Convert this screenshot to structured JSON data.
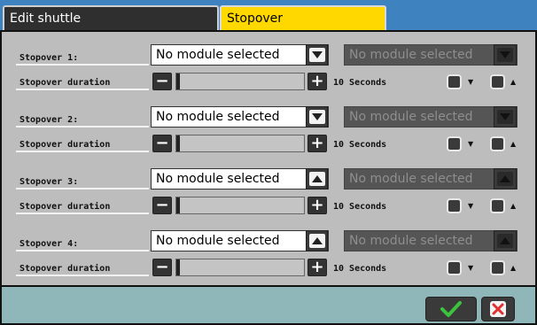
{
  "tabs": {
    "edit_label": "Edit shuttle",
    "stopover_label": "Stopover"
  },
  "stopovers": [
    {
      "label": "Stopover 1:",
      "select_value": "No module selected",
      "select2_value": "No module selected",
      "duration_label": "Stopover duration",
      "duration_text": "10 Seconds",
      "btn_dir": "down"
    },
    {
      "label": "Stopover 2:",
      "select_value": "No module selected",
      "select2_value": "No module selected",
      "duration_label": "Stopover duration",
      "duration_text": "10 Seconds",
      "btn_dir": "down"
    },
    {
      "label": "Stopover 3:",
      "select_value": "No module selected",
      "select2_value": "No module selected",
      "duration_label": "Stopover duration",
      "duration_text": "10 Seconds",
      "btn_dir": "up"
    },
    {
      "label": "Stopover 4:",
      "select_value": "No module selected",
      "select2_value": "No module selected",
      "duration_label": "Stopover duration",
      "duration_text": "10 Seconds",
      "btn_dir": "up"
    }
  ],
  "colors": {
    "tab_active": "#ffd800",
    "tab_inactive": "#2f2f2f",
    "tabbar": "#3f82c0",
    "panel": "#bdbdbd",
    "footer": "#8fb6b8",
    "ok_check": "#3cc23c",
    "cancel_x": "#e03030"
  },
  "icons": {
    "ok": "checkmark-icon",
    "cancel": "close-icon"
  }
}
